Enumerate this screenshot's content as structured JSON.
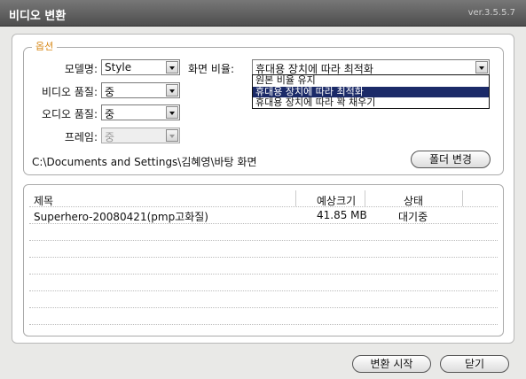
{
  "window": {
    "title": "비디오 변환",
    "version": "ver.3.5.5.7"
  },
  "options": {
    "legend": "옵션",
    "model": {
      "label": "모델명:",
      "value": "Style"
    },
    "video_quality": {
      "label": "비디오 품질:",
      "value": "중"
    },
    "audio_quality": {
      "label": "오디오 품질:",
      "value": "중"
    },
    "frame": {
      "label": "프레임:",
      "value": "중"
    },
    "screen_ratio": {
      "label": "화면 비율:",
      "value": "휴대용 장치에 따라 최적화",
      "options": [
        "원본 비율 유지",
        "휴대용 장치에 따라 최적화",
        "휴대용 장치에 따라 꽉 채우기"
      ],
      "selected_index": 1
    },
    "path": "C:\\Documents and Settings\\김혜영\\바탕 화면",
    "folder_button": "폴더 변경"
  },
  "table": {
    "columns": [
      "제목",
      "예상크기",
      "상태"
    ],
    "rows": [
      {
        "title": "Superhero-20080421(pmp고화질)",
        "size": "41.85 MB",
        "status": "대기중"
      }
    ]
  },
  "footer": {
    "start_button": "변환 시작",
    "close_button": "닫기"
  }
}
